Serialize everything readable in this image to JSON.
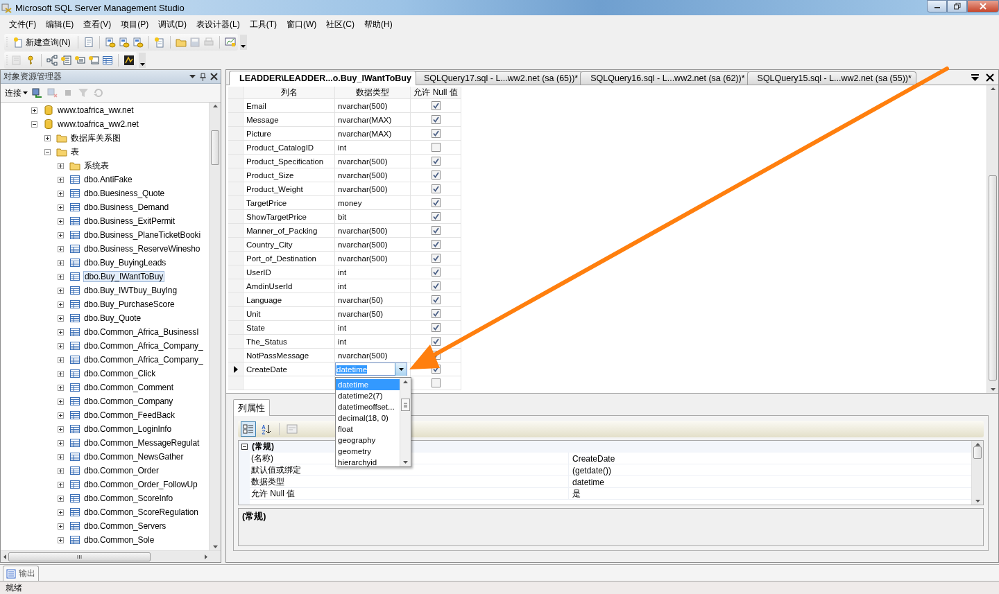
{
  "window": {
    "title": "Microsoft SQL Server Management Studio"
  },
  "menu": [
    "文件(F)",
    "编辑(E)",
    "查看(V)",
    "项目(P)",
    "调试(D)",
    "表设计器(L)",
    "工具(T)",
    "窗口(W)",
    "社区(C)",
    "帮助(H)"
  ],
  "toolbar_1": {
    "new_query": "新建查询(N)",
    "buttons": [
      {
        "disabled": false
      },
      {
        "disabled": false
      },
      {
        "disabled": false
      },
      {
        "disabled": false
      },
      {
        "disabled": false
      },
      {
        "disabled": false
      },
      {
        "disabled": true
      },
      {
        "disabled": true
      },
      {
        "disabled": false
      }
    ]
  },
  "toolbar_2": {
    "buttons": [
      {
        "disabled": true
      },
      {
        "disabled": false
      },
      {
        "disabled": false
      },
      {
        "disabled": false
      },
      {
        "disabled": false
      },
      {
        "disabled": false
      },
      {
        "disabled": false
      },
      {
        "disabled": false
      }
    ]
  },
  "object_explorer": {
    "title": "对象资源管理器",
    "connect": "连接",
    "buttons": [
      {
        "disabled": false
      },
      {
        "disabled": true
      },
      {
        "disabled": true
      },
      {
        "disabled": true
      },
      {
        "disabled": true
      }
    ],
    "tree": [
      {
        "label": "www.toafrica_ww.net",
        "kind": "database",
        "expanded": false,
        "selected": false
      },
      {
        "label": "www.toafrica_ww2.net",
        "kind": "database",
        "expanded": true,
        "selected": false,
        "children": [
          {
            "label": "数据库关系图",
            "kind": "folder",
            "expanded": false,
            "selected": false
          },
          {
            "label": "表",
            "kind": "folder",
            "expanded": true,
            "selected": false,
            "children": [
              {
                "label": "系统表",
                "kind": "folder",
                "expanded": false,
                "selected": false
              },
              {
                "label": "dbo.AntiFake",
                "kind": "table",
                "expanded": false,
                "selected": false
              },
              {
                "label": "dbo.Buesiness_Quote",
                "kind": "table",
                "expanded": false,
                "selected": false
              },
              {
                "label": "dbo.Business_Demand",
                "kind": "table",
                "expanded": false,
                "selected": false
              },
              {
                "label": "dbo.Business_ExitPermit",
                "kind": "table",
                "expanded": false,
                "selected": false
              },
              {
                "label": "dbo.Business_PlaneTicketBooki",
                "kind": "table",
                "expanded": false,
                "selected": false
              },
              {
                "label": "dbo.Business_ReserveWinesho",
                "kind": "table",
                "expanded": false,
                "selected": false
              },
              {
                "label": "dbo.Buy_BuyingLeads",
                "kind": "table",
                "expanded": false,
                "selected": false
              },
              {
                "label": "dbo.Buy_IWantToBuy",
                "kind": "table",
                "expanded": false,
                "selected": true
              },
              {
                "label": "dbo.Buy_IWTbuy_BuyIng",
                "kind": "table",
                "expanded": false,
                "selected": false
              },
              {
                "label": "dbo.Buy_PurchaseScore",
                "kind": "table",
                "expanded": false,
                "selected": false
              },
              {
                "label": "dbo.Buy_Quote",
                "kind": "table",
                "expanded": false,
                "selected": false
              },
              {
                "label": "dbo.Common_Africa_BusinessI",
                "kind": "table",
                "expanded": false,
                "selected": false
              },
              {
                "label": "dbo.Common_Africa_Company_",
                "kind": "table",
                "expanded": false,
                "selected": false
              },
              {
                "label": "dbo.Common_Africa_Company_",
                "kind": "table",
                "expanded": false,
                "selected": false
              },
              {
                "label": "dbo.Common_Click",
                "kind": "table",
                "expanded": false,
                "selected": false
              },
              {
                "label": "dbo.Common_Comment",
                "kind": "table",
                "expanded": false,
                "selected": false
              },
              {
                "label": "dbo.Common_Company",
                "kind": "table",
                "expanded": false,
                "selected": false
              },
              {
                "label": "dbo.Common_FeedBack",
                "kind": "table",
                "expanded": false,
                "selected": false
              },
              {
                "label": "dbo.Common_LoginInfo",
                "kind": "table",
                "expanded": false,
                "selected": false
              },
              {
                "label": "dbo.Common_MessageRegulat",
                "kind": "table",
                "expanded": false,
                "selected": false
              },
              {
                "label": "dbo.Common_NewsGather",
                "kind": "table",
                "expanded": false,
                "selected": false
              },
              {
                "label": "dbo.Common_Order",
                "kind": "table",
                "expanded": false,
                "selected": false
              },
              {
                "label": "dbo.Common_Order_FollowUp",
                "kind": "table",
                "expanded": false,
                "selected": false
              },
              {
                "label": "dbo.Common_ScoreInfo",
                "kind": "table",
                "expanded": false,
                "selected": false
              },
              {
                "label": "dbo.Common_ScoreRegulation",
                "kind": "table",
                "expanded": false,
                "selected": false
              },
              {
                "label": "dbo.Common_Servers",
                "kind": "table",
                "expanded": false,
                "selected": false
              },
              {
                "label": "dbo.Common_Sole",
                "kind": "table",
                "expanded": false,
                "selected": false
              }
            ]
          }
        ]
      }
    ]
  },
  "tabs": [
    {
      "label": "LEADDER\\LEADDER...o.Buy_IWantToBuy",
      "selected": true
    },
    {
      "label": "SQLQuery17.sql - L...ww2.net (sa (65))*",
      "selected": false
    },
    {
      "label": "SQLQuery16.sql - L...ww2.net (sa (62))*",
      "selected": false
    },
    {
      "label": "SQLQuery15.sql - L...ww2.net (sa (55))*",
      "selected": false
    }
  ],
  "designer": {
    "columns": [
      "列名",
      "数据类型",
      "允许 Null 值"
    ],
    "rows": [
      {
        "name": "Email",
        "type": "nvarchar(500)",
        "allow_null": true,
        "current": false
      },
      {
        "name": "Message",
        "type": "nvarchar(MAX)",
        "allow_null": true,
        "current": false
      },
      {
        "name": "Picture",
        "type": "nvarchar(MAX)",
        "allow_null": true,
        "current": false
      },
      {
        "name": "Product_CatalogID",
        "type": "int",
        "allow_null": false,
        "current": false
      },
      {
        "name": "Product_Specification",
        "type": "nvarchar(500)",
        "allow_null": true,
        "current": false
      },
      {
        "name": "Product_Size",
        "type": "nvarchar(500)",
        "allow_null": true,
        "current": false
      },
      {
        "name": "Product_Weight",
        "type": "nvarchar(500)",
        "allow_null": true,
        "current": false
      },
      {
        "name": "TargetPrice",
        "type": "money",
        "allow_null": true,
        "current": false
      },
      {
        "name": "ShowTargetPrice",
        "type": "bit",
        "allow_null": true,
        "current": false
      },
      {
        "name": "Manner_of_Packing",
        "type": "nvarchar(500)",
        "allow_null": true,
        "current": false
      },
      {
        "name": "Country_City",
        "type": "nvarchar(500)",
        "allow_null": true,
        "current": false
      },
      {
        "name": "Port_of_Destination",
        "type": "nvarchar(500)",
        "allow_null": true,
        "current": false
      },
      {
        "name": "UserID",
        "type": "int",
        "allow_null": true,
        "current": false
      },
      {
        "name": "AmdinUserId",
        "type": "int",
        "allow_null": true,
        "current": false
      },
      {
        "name": "Language",
        "type": "nvarchar(50)",
        "allow_null": true,
        "current": false
      },
      {
        "name": "Unit",
        "type": "nvarchar(50)",
        "allow_null": true,
        "current": false
      },
      {
        "name": "State",
        "type": "int",
        "allow_null": true,
        "current": false
      },
      {
        "name": "The_Status",
        "type": "int",
        "allow_null": true,
        "current": false
      },
      {
        "name": "NotPassMessage",
        "type": "nvarchar(500)",
        "allow_null": true,
        "current": false
      },
      {
        "name": "CreateDate",
        "type": "datetime",
        "allow_null": true,
        "current": true
      },
      {
        "allow_null": false,
        "current": false
      }
    ],
    "type_dropdown": {
      "items": [
        {
          "label": "datetime",
          "selected": true
        },
        {
          "label": "datetime2(7)",
          "selected": false
        },
        {
          "label": "datetimeoffset...",
          "selected": false
        },
        {
          "label": "decimal(18, 0)",
          "selected": false
        },
        {
          "label": "float",
          "selected": false
        },
        {
          "label": "geography",
          "selected": false
        },
        {
          "label": "geometry",
          "selected": false
        },
        {
          "label": "hierarchyid",
          "selected": false
        }
      ]
    }
  },
  "properties": {
    "tab": "列属性",
    "toolbar": [
      {
        "selected": true
      },
      {
        "selected": false
      },
      {
        "selected": false
      }
    ],
    "categories": [
      {
        "name": "(常规)",
        "expanded": true,
        "rows": [
          {
            "name": "(名称)",
            "value": "CreateDate"
          },
          {
            "name": "默认值或绑定",
            "value": "(getdate())"
          },
          {
            "name": "数据类型",
            "value": "datetime"
          },
          {
            "name": "允许 Null 值",
            "value": "是"
          }
        ]
      }
    ],
    "description": "(常规)"
  },
  "output_tab": "输出",
  "status_bar": "就绪"
}
